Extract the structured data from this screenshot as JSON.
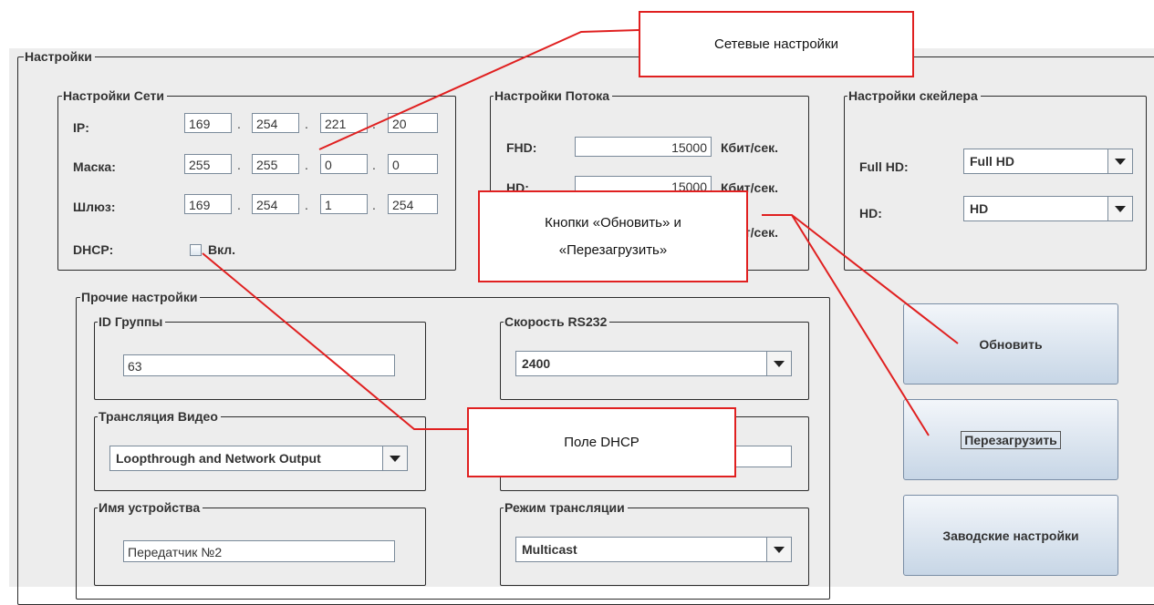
{
  "settings": {
    "title": "Настройки",
    "network": {
      "title": "Настройки Сети",
      "ip_label": "IP:",
      "ip": [
        "169",
        "254",
        "221",
        "20"
      ],
      "mask_label": "Маска:",
      "mask": [
        "255",
        "255",
        "0",
        "0"
      ],
      "gateway_label": "Шлюз:",
      "gateway": [
        "169",
        "254",
        "1",
        "254"
      ],
      "dot": ".",
      "dhcp_label": "DHCP:",
      "dhcp_checkbox_label": "Вкл.",
      "dhcp_checked": false
    },
    "stream": {
      "title": "Настройки Потока",
      "fhd_label": "FHD:",
      "fhd_value": "15000",
      "hd_label": "HD:",
      "hd_value": "15000",
      "unit": "Кбит/сек."
    },
    "scaler": {
      "title": "Настройки скейлера",
      "fullhd_label": "Full HD:",
      "fullhd_value": "Full HD",
      "hd_label": "HD:",
      "hd_value": "HD"
    },
    "other": {
      "title": "Прочие настройки",
      "group_id_title": "ID Группы",
      "group_id_value": "63",
      "rs232_title": "Скорость RS232",
      "rs232_value": "2400",
      "video_title": "Трансляция Видео",
      "video_value": "Loopthrough and Network Output",
      "device_name_title": "Имя устройства",
      "device_name_value": "Передатчик №2",
      "mode_title": "Режим трансляции",
      "mode_value": "Multicast"
    },
    "buttons": {
      "update": "Обновить",
      "reboot": "Перезагрузить",
      "factory": "Заводские настройки"
    }
  },
  "annotations": {
    "network_callout": "Сетевые настройки",
    "buttons_callout_line1": "Кнопки «Обновить» и",
    "buttons_callout_line2": "«Перезагрузить»",
    "dhcp_callout": "Поле DHCP",
    "callout_color": "#e02020"
  },
  "icons": {
    "dropdown": "chevron-down-icon"
  }
}
